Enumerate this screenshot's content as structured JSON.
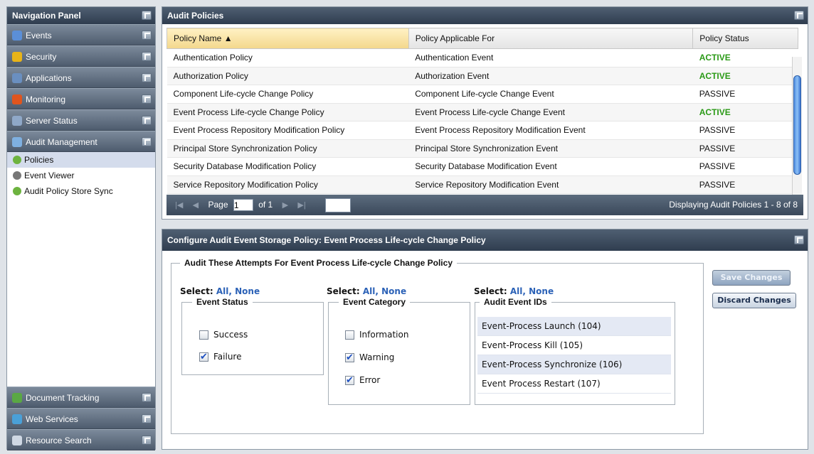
{
  "nav": {
    "title": "Navigation Panel",
    "sections_top": [
      {
        "label": "Events",
        "icon": "events-icon",
        "color": "#5b8fd8"
      },
      {
        "label": "Security",
        "icon": "lock-icon",
        "color": "#e9b418"
      },
      {
        "label": "Applications",
        "icon": "applications-icon",
        "color": "#6a8fc0"
      },
      {
        "label": "Monitoring",
        "icon": "monitoring-icon",
        "color": "#e0551e"
      },
      {
        "label": "Server Status",
        "icon": "server-status-icon",
        "color": "#8fa8c8"
      },
      {
        "label": "Audit Management",
        "icon": "audit-management-icon",
        "color": "#7fb0e0"
      }
    ],
    "subitems": [
      {
        "label": "Policies",
        "icon": "policies-icon",
        "color": "#6db33f",
        "selected": true
      },
      {
        "label": "Event Viewer",
        "icon": "event-viewer-icon",
        "color": "#777777",
        "selected": false
      },
      {
        "label": "Audit Policy Store Sync",
        "icon": "sync-icon",
        "color": "#6db33f",
        "selected": false
      }
    ],
    "sections_bottom": [
      {
        "label": "Document Tracking",
        "icon": "document-tracking-icon",
        "color": "#5aa844"
      },
      {
        "label": "Web Services",
        "icon": "web-services-icon",
        "color": "#4aa0d8"
      },
      {
        "label": "Resource Search",
        "icon": "resource-search-icon",
        "color": "#cfd8e4"
      }
    ]
  },
  "policies": {
    "title": "Audit Policies",
    "columns": [
      "Policy Name ▲",
      "Policy Applicable For",
      "Policy Status"
    ],
    "rows": [
      [
        "Authentication Policy",
        "Authentication Event",
        "ACTIVE"
      ],
      [
        "Authorization Policy",
        "Authorization Event",
        "ACTIVE"
      ],
      [
        "Component Life-cycle Change Policy",
        "Component Life-cycle Change Event",
        "PASSIVE"
      ],
      [
        "Event Process Life-cycle Change Policy",
        "Event Process Life-cycle Change Event",
        "ACTIVE"
      ],
      [
        "Event Process Repository Modification Policy",
        "Event Process Repository Modification Event",
        "PASSIVE"
      ],
      [
        "Principal Store Synchronization Policy",
        "Principal Store Synchronization Event",
        "PASSIVE"
      ],
      [
        "Security Database Modification Policy",
        "Security Database Modification Event",
        "PASSIVE"
      ],
      [
        "Service Repository Modification Policy",
        "Service Repository Modification Event",
        "PASSIVE"
      ]
    ],
    "active_color": "#2b9a17",
    "pager": {
      "page_label": "Page",
      "page_value": "1",
      "of_label": "of 1",
      "info": "Displaying Audit Policies 1 - 8 of 8"
    }
  },
  "config": {
    "title": "Configure Audit Event Storage Policy: Event Process Life-cycle Change Policy",
    "outer_legend": "Audit These Attempts For Event Process Life-cycle Change Policy",
    "select_label": "Select:",
    "all_label": "All,",
    "none_label": "None",
    "event_status": {
      "legend": "Event Status",
      "options": [
        {
          "label": "Success",
          "checked": false
        },
        {
          "label": "Failure",
          "checked": true
        }
      ]
    },
    "event_category": {
      "legend": "Event Category",
      "options": [
        {
          "label": "Information",
          "checked": false
        },
        {
          "label": "Warning",
          "checked": true
        },
        {
          "label": "Error",
          "checked": true
        }
      ]
    },
    "audit_event_ids": {
      "legend": "Audit Event IDs",
      "items": [
        {
          "label": "Event-Process Launch (104)",
          "highlighted": true
        },
        {
          "label": "Event-Process Kill (105)",
          "highlighted": false
        },
        {
          "label": "Event-Process Synchronize (106)",
          "highlighted": true
        },
        {
          "label": "Event Process Restart (107)",
          "highlighted": false
        }
      ]
    },
    "save_label": "Save Changes",
    "discard_label": "Discard Changes"
  }
}
